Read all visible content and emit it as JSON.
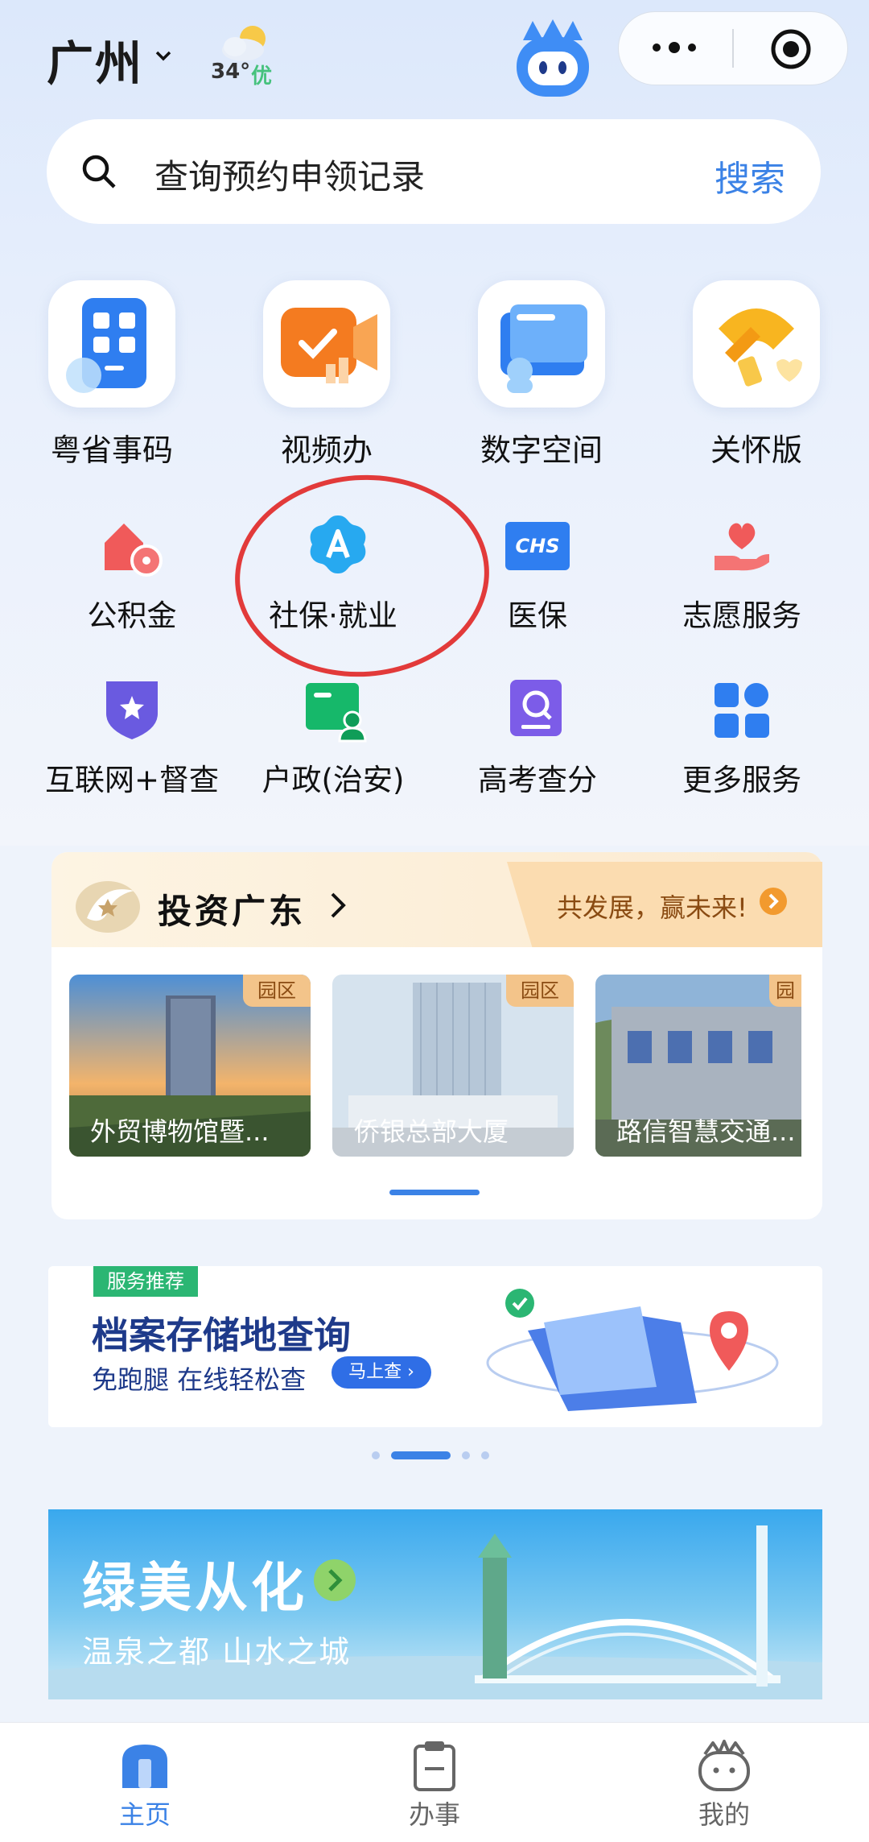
{
  "header": {
    "city": "广州",
    "weather": {
      "temp": "34°",
      "aqi": "优"
    }
  },
  "search": {
    "placeholder": "查询预约申领记录",
    "button": "搜索"
  },
  "primary_services": [
    {
      "label": "粤省事码",
      "icon": "qr-code-icon"
    },
    {
      "label": "视频办",
      "icon": "video-icon"
    },
    {
      "label": "数字空间",
      "icon": "folder-card-icon"
    },
    {
      "label": "关怀版",
      "icon": "ribbon-icon"
    }
  ],
  "services": [
    {
      "label": "公积金",
      "icon": "house-fund-icon"
    },
    {
      "label": "社保·就业",
      "icon": "social-security-icon"
    },
    {
      "label": "医保",
      "icon": "chs-icon",
      "icon_text": "CHS"
    },
    {
      "label": "志愿服务",
      "icon": "heart-hand-icon"
    },
    {
      "label": "互联网+督查",
      "icon": "shield-star-icon"
    },
    {
      "label": "户政(治安)",
      "icon": "id-card-icon"
    },
    {
      "label": "高考查分",
      "icon": "search-doc-icon"
    },
    {
      "label": "更多服务",
      "icon": "grid-icon"
    }
  ],
  "invest": {
    "title": "投资广东",
    "slogan": "共发展，赢未来!",
    "cards": [
      {
        "tag": "园区",
        "caption": "外贸博物馆暨..."
      },
      {
        "tag": "园区",
        "caption": "侨银总部大厦"
      },
      {
        "tag": "园",
        "caption": "路信智慧交通..."
      }
    ]
  },
  "recommend": {
    "tag": "服务推荐",
    "title": "档案存储地查询",
    "subtitle": "免跑腿 在线轻松查",
    "button": "马上查 ›"
  },
  "banner2": {
    "title": "绿美从化",
    "subtitle": "温泉之都 山水之城"
  },
  "tabbar": [
    {
      "label": "主页",
      "active": true
    },
    {
      "label": "办事",
      "active": false
    },
    {
      "label": "我的",
      "active": false
    }
  ],
  "colors": {
    "accent": "#3b82e6",
    "annotation": "#e23a3a",
    "recommend_tag": "#2bb673"
  }
}
